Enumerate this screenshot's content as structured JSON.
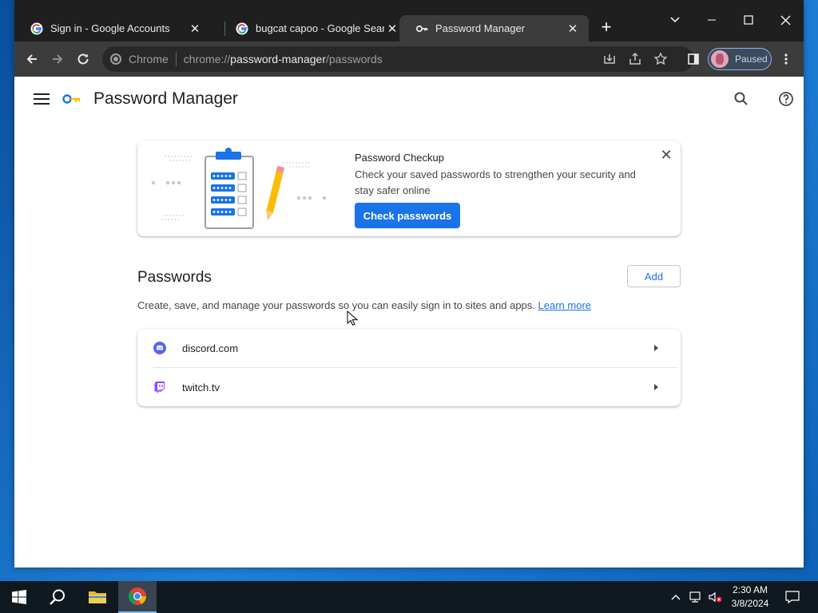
{
  "browser": {
    "tabs": [
      {
        "title": "Sign in - Google Accounts",
        "favicon": "google-g-icon",
        "active": false
      },
      {
        "title": "bugcat capoo - Google Search",
        "favicon": "google-g-icon",
        "active": false
      },
      {
        "title": "Password Manager",
        "favicon": "key-icon",
        "active": true
      }
    ],
    "omnibox": {
      "chip_label": "Chrome",
      "url_scheme": "chrome://",
      "url_host": "password-manager",
      "url_path": "/passwords"
    },
    "profile_label": "Paused"
  },
  "app": {
    "title": "Password Manager"
  },
  "checkup": {
    "title": "Password Checkup",
    "description": "Check your saved passwords to strengthen your security and stay safer online",
    "button_label": "Check passwords"
  },
  "passwords": {
    "title": "Passwords",
    "add_label": "Add",
    "description": "Create, save, and manage your passwords so you can easily sign in to sites and apps.",
    "learn_more": "Learn more",
    "items": [
      {
        "site": "discord.com",
        "icon": "discord-icon",
        "color": "#5865f2"
      },
      {
        "site": "twitch.tv",
        "icon": "twitch-icon",
        "color": "#9146ff"
      }
    ]
  },
  "taskbar": {
    "time": "2:30 AM",
    "date": "3/8/2024"
  },
  "colors": {
    "accent": "#1a73e8",
    "tabstrip": "#1f1f1f",
    "toolbar": "#3c3c3c"
  }
}
